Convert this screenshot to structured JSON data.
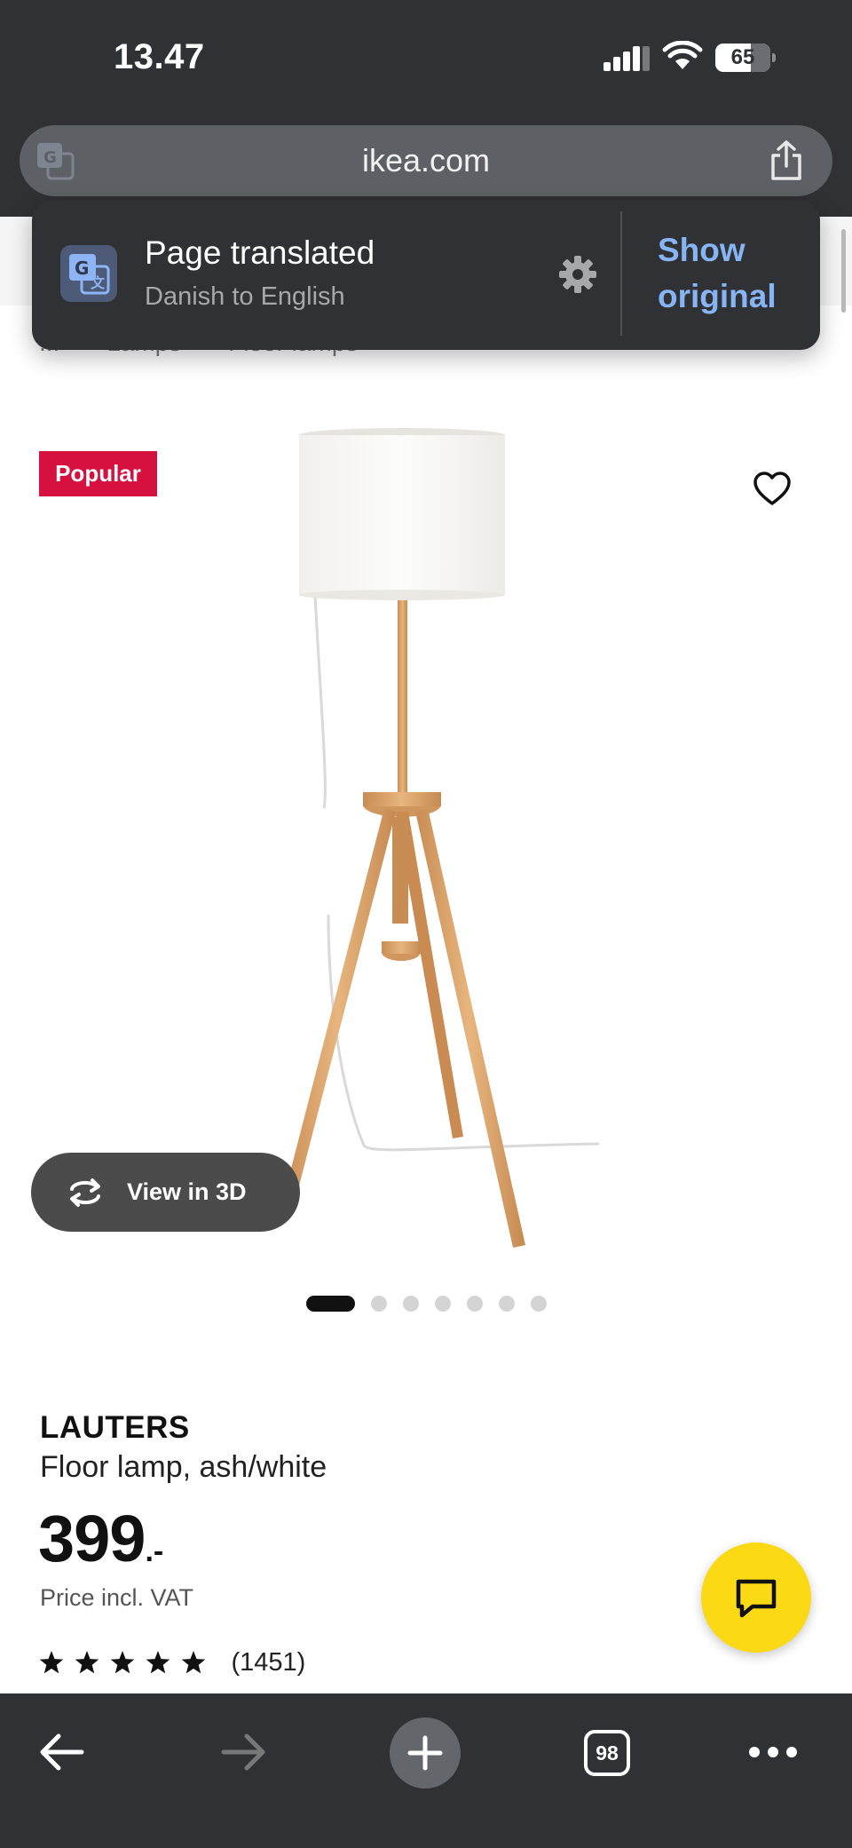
{
  "status_bar": {
    "time": "13.47",
    "battery_level": "65"
  },
  "browser": {
    "url": "ikea.com",
    "tabs_count": "98"
  },
  "translate_popup": {
    "title": "Page translated",
    "subtitle": "Danish to English",
    "action_label": "Show original"
  },
  "breadcrumb": {
    "items": [
      "...",
      "Lamps",
      "Floor lamps"
    ]
  },
  "product": {
    "badge": "Popular",
    "view_3d_label": "View in 3D",
    "name": "LAUTERS",
    "description": "Floor lamp, ash/white",
    "price": "399",
    "price_suffix": ".-",
    "vat_note": "Price incl. VAT",
    "rating_stars": 5,
    "rating_count": "(1451)",
    "image_count": 7,
    "active_image_index": 0
  },
  "icons": {
    "favorite": "heart-outline-icon",
    "chat": "chat-bubble-icon",
    "share": "share-icon",
    "settings": "gear-icon",
    "translate": "google-translate-icon",
    "view_3d": "rotate-3d-icon"
  },
  "colors": {
    "browser_chrome": "#2f3135",
    "badge_red": "#d6103f",
    "chat_yellow": "#fbd914",
    "link_blue": "#87b4f3"
  }
}
